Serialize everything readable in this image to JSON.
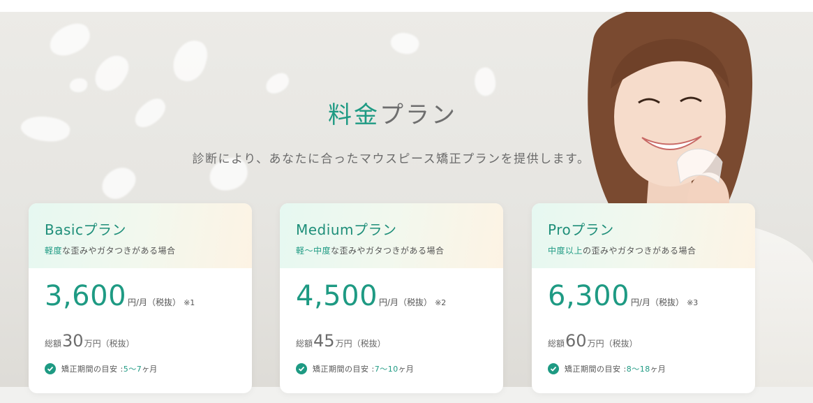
{
  "section": {
    "title_accent": "料金",
    "title_rest": "プラン",
    "subtitle": "診断により、あなたに合ったマウスピース矯正プランを提供します。"
  },
  "plans": [
    {
      "name": "Basicプラン",
      "note_highlight": "軽度",
      "note_rest": "な歪みやガタつきがある場合",
      "price": "3,600",
      "price_unit": "円/月（税抜）",
      "price_note": "※1",
      "total_label": "総額",
      "total_value": "30",
      "total_unit": "万円（税抜）",
      "period_label": "矯正期間の目安 :",
      "period_value": "5〜7",
      "period_unit": "ヶ月"
    },
    {
      "name": "Mediumプラン",
      "note_highlight": "軽〜中度",
      "note_rest": "な歪みやガタつきがある場合",
      "price": "4,500",
      "price_unit": "円/月（税抜）",
      "price_note": "※2",
      "total_label": "総額",
      "total_value": "45",
      "total_unit": "万円（税抜）",
      "period_label": "矯正期間の目安 :",
      "period_value": "7〜10",
      "period_unit": "ヶ月"
    },
    {
      "name": "Proプラン",
      "note_highlight": "中度以上",
      "note_rest": "の歪みやガタつきがある場合",
      "price": "6,300",
      "price_unit": "円/月（税抜）",
      "price_note": "※3",
      "total_label": "総額",
      "total_value": "60",
      "total_unit": "万円（税抜）",
      "period_label": "矯正期間の目安 :",
      "period_value": "8〜18",
      "period_unit": "ヶ月"
    }
  ],
  "colors": {
    "accent": "#1e9a83",
    "text": "#555555",
    "background": "#ecebe7"
  },
  "icons": {
    "check": "check-circle-icon"
  }
}
